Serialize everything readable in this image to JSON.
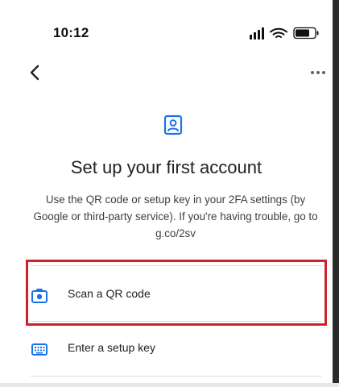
{
  "status_bar": {
    "time": "10:12",
    "icons": [
      "signal-icon",
      "wifi-icon",
      "battery-icon"
    ]
  },
  "app_bar": {
    "back_icon": "chevron-left-icon",
    "more_icon": "more-horizontal-icon"
  },
  "header": {
    "icon": "account-box-icon",
    "title": "Set up your first account",
    "description": "Use the QR code or setup key in your 2FA settings (by Google or third-party service). If you're having trouble, go to g.co/2sv"
  },
  "options": [
    {
      "label": "Scan a QR code",
      "icon": "camera-icon"
    },
    {
      "label": "Enter a setup key",
      "icon": "keyboard-icon"
    }
  ],
  "colors": {
    "accent": "#1a73e8",
    "highlight": "#d11f2c",
    "divider": "#dadce0",
    "text": "#202124"
  }
}
